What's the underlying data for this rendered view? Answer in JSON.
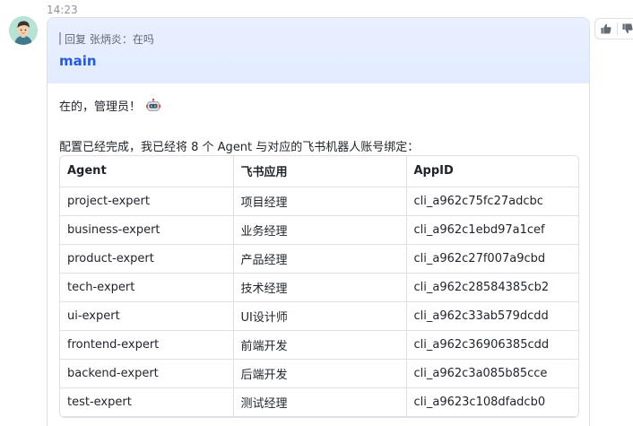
{
  "message": {
    "timestamp": "14:23",
    "reply_quote": "回复 张炳炎：在吗",
    "card_title": "main",
    "greeting": "在的，管理员！",
    "intro": "配置已经完成，我已经将 8 个 Agent 与对应的飞书机器人账号绑定：",
    "table": {
      "headers": [
        "Agent",
        "飞书应用",
        "AppID"
      ],
      "rows": [
        [
          "project-expert",
          "项目经理",
          "cli_a962c75fc27adcbc"
        ],
        [
          "business-expert",
          "业务经理",
          "cli_a962c1ebd97a1cef"
        ],
        [
          "product-expert",
          "产品经理",
          "cli_a962c27f007a9cbd"
        ],
        [
          "tech-expert",
          "技术经理",
          "cli_a962c28584385cb2"
        ],
        [
          "ui-expert",
          "UI设计师",
          "cli_a962c33ab579dcdd"
        ],
        [
          "frontend-expert",
          "前端开发",
          "cli_a962c36906385cdd"
        ],
        [
          "backend-expert",
          "后端开发",
          "cli_a962c3a085b85cce"
        ],
        [
          "test-expert",
          "测试经理",
          "cli_a9623c108dfadcb0"
        ]
      ]
    }
  },
  "icons": {
    "avatar": "user-avatar",
    "emoji": "robot-emoji",
    "thumbs_up": "thumbs-up-icon",
    "thumbs_down": "thumbs-down-icon"
  },
  "colors": {
    "header_bg": "#e3ecff",
    "title": "#245bdb",
    "border": "#dee0e3",
    "muted_text": "#8f959e"
  }
}
